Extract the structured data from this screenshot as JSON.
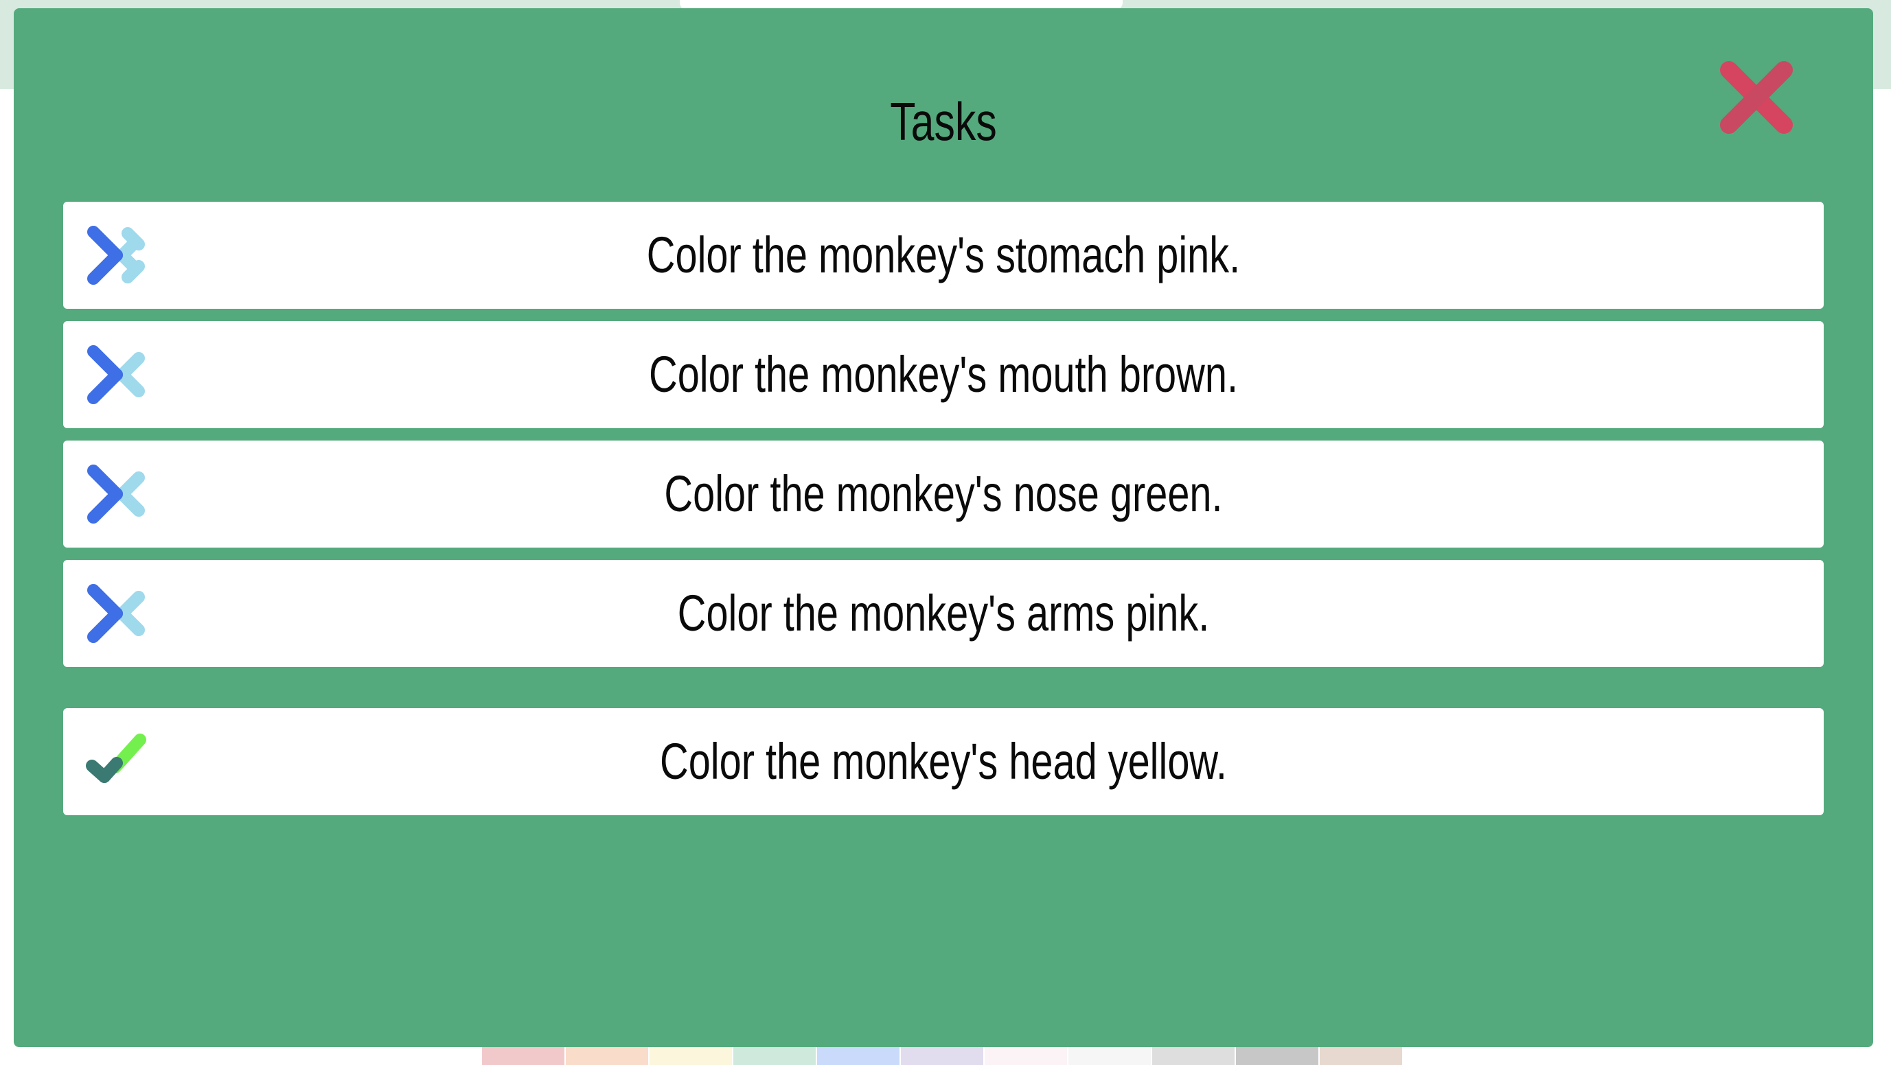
{
  "modal": {
    "title": "Tasks",
    "close_icon": "close-icon",
    "close_color": "#d64560"
  },
  "tasks": [
    {
      "label": "Color the monkey's stomach pink.",
      "status": "incomplete",
      "icon": "cross-icon"
    },
    {
      "label": "Color the monkey's mouth brown.",
      "status": "incomplete",
      "icon": "cross-icon"
    },
    {
      "label": "Color the monkey's nose green.",
      "status": "incomplete",
      "icon": "cross-icon"
    },
    {
      "label": "Color the monkey's arms pink.",
      "status": "incomplete",
      "icon": "cross-icon"
    },
    {
      "label": "Color the monkey's head yellow.",
      "status": "complete",
      "icon": "check-icon"
    }
  ],
  "colors": {
    "modal_bg": "#54aa7d",
    "cross_dark": "#3f6fe6",
    "cross_light": "#9ed9ec",
    "check_dark": "#3a7a72",
    "check_light": "#74f04e"
  },
  "palette_swatches": [
    "#f2c9cb",
    "#f9dcc9",
    "#fbf6dc",
    "#cfe9dc",
    "#c9dafa",
    "#e2dcef",
    "#fbf3f6",
    "#f6f6f6",
    "#dedede",
    "#c7c7c7",
    "#e7d9cf"
  ]
}
